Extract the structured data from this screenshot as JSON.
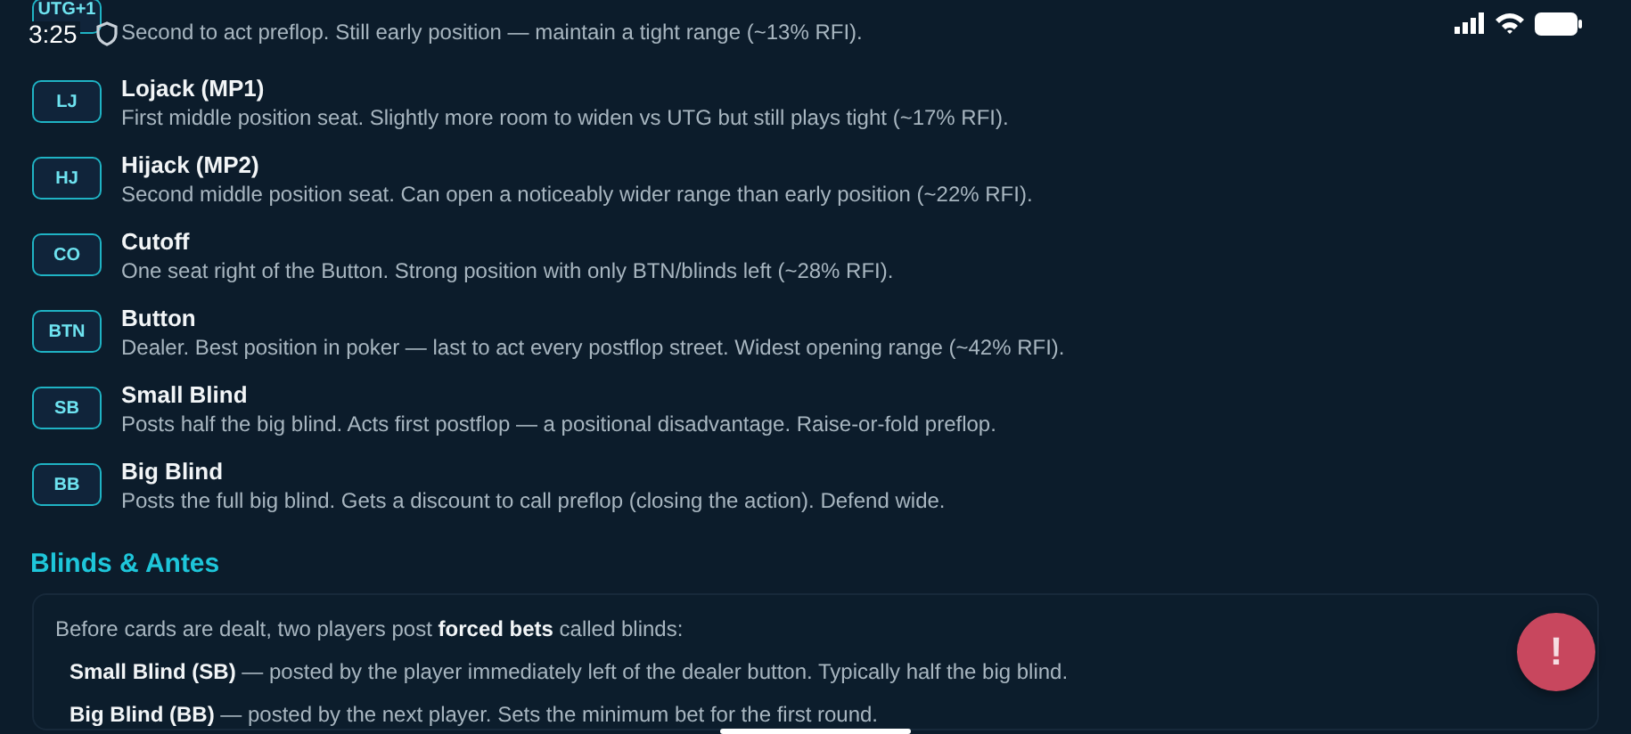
{
  "status_bar": {
    "time": "3:25"
  },
  "positions": [
    {
      "badge": "UTG+1",
      "description": "Second to act preflop. Still early position — maintain a tight range (~13% RFI)."
    },
    {
      "badge": "LJ",
      "title": "Lojack (MP1)",
      "description": "First middle position seat. Slightly more room to widen vs UTG but still plays tight (~17% RFI)."
    },
    {
      "badge": "HJ",
      "title": "Hijack (MP2)",
      "description": "Second middle position seat. Can open a noticeably wider range than early position (~22% RFI)."
    },
    {
      "badge": "CO",
      "title": "Cutoff",
      "description": "One seat right of the Button. Strong position with only BTN/blinds left (~28% RFI)."
    },
    {
      "badge": "BTN",
      "title": "Button",
      "description": "Dealer. Best position in poker — last to act every postflop street. Widest opening range (~42% RFI)."
    },
    {
      "badge": "SB",
      "title": "Small Blind",
      "description": "Posts half the big blind. Acts first postflop — a positional disadvantage. Raise-or-fold preflop."
    },
    {
      "badge": "BB",
      "title": "Big Blind",
      "description": "Posts the full big blind. Gets a discount to call preflop (closing the action). Defend wide."
    }
  ],
  "section": {
    "heading": "Blinds & Antes",
    "intro": "Before cards are dealt, two players post **forced bets** called blinds:",
    "items": [
      "**Small Blind (SB)** — posted by the player immediately left of the dealer button. Typically half the big blind.",
      "**Big Blind (BB)** — posted by the next player. Sets the minimum bet for the first round."
    ]
  },
  "fab": {
    "label": "!"
  }
}
